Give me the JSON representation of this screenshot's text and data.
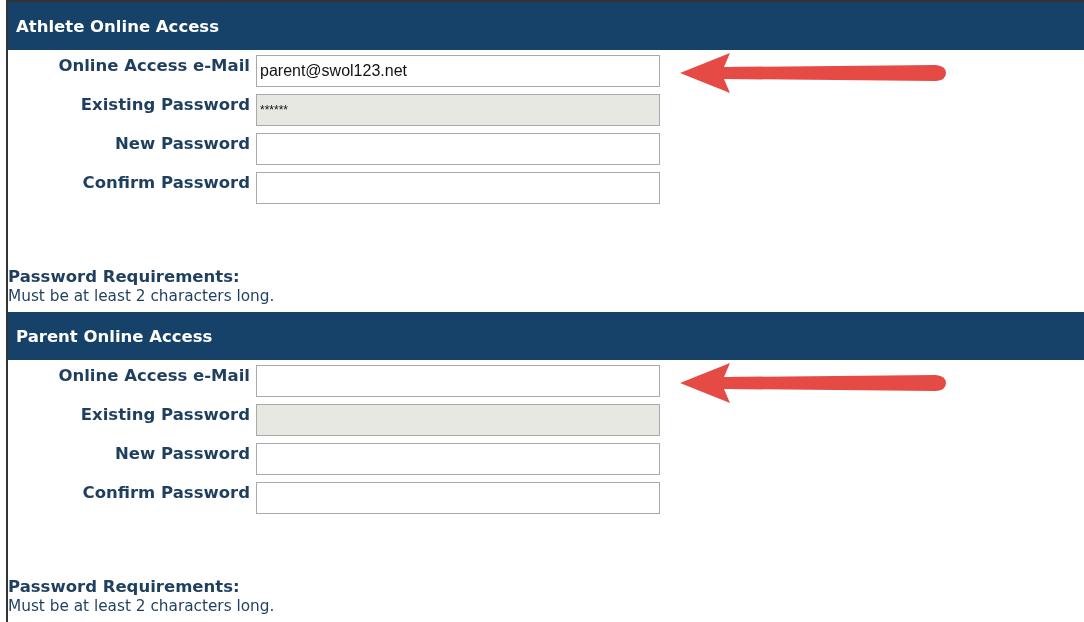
{
  "sections": [
    {
      "title": "Athlete Online Access",
      "fields": [
        {
          "label": "Online Access e-Mail",
          "value": "parent@swol123.net",
          "disabled": false,
          "arrow": true
        },
        {
          "label": "Existing Password",
          "value": "******",
          "disabled": true,
          "arrow": false
        },
        {
          "label": "New Password",
          "disabled": false,
          "arrow": false
        },
        {
          "label": "Confirm Password",
          "disabled": false,
          "arrow": false
        }
      ],
      "requirements_title": "Password Requirements:",
      "requirements_text": "Must be at least 2 characters long."
    },
    {
      "title": "Parent Online Access",
      "fields": [
        {
          "label": "Online Access e-Mail",
          "disabled": false,
          "arrow": true
        },
        {
          "label": "Existing Password",
          "disabled": true,
          "arrow": false
        },
        {
          "label": "New Password",
          "disabled": false,
          "arrow": false
        },
        {
          "label": "Confirm Password",
          "disabled": false,
          "arrow": false
        }
      ],
      "requirements_title": "Password Requirements:",
      "requirements_text": "Must be at least 2 characters long."
    }
  ]
}
